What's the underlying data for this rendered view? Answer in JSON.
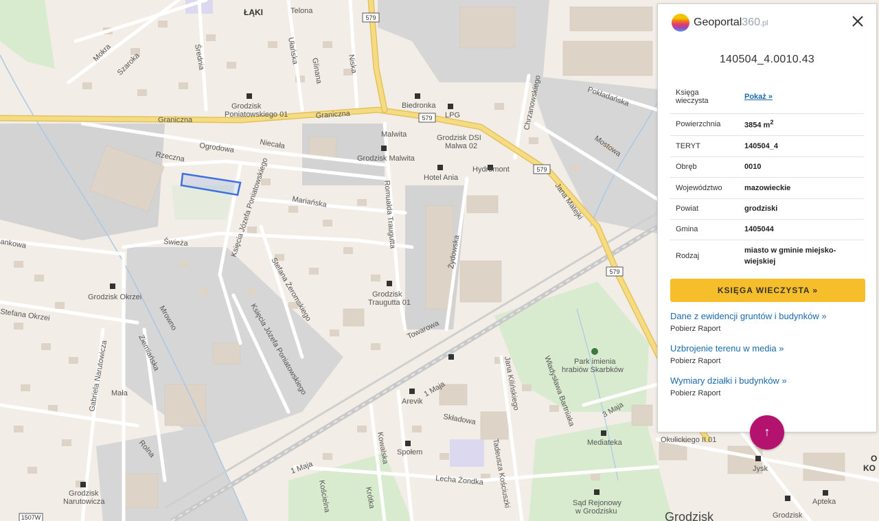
{
  "map": {
    "labels": {
      "laki": "ŁĄKI",
      "telona": "Telona",
      "mokra": "Mokra",
      "szaroka": "Szaroka",
      "srednia": "Średnia",
      "ulanska": "Ułańska",
      "glinana": "Glinana",
      "niska": "Niska",
      "graniczna1": "Graniczna",
      "graniczna2": "Graniczna",
      "stop_poniatowskiego": "Grodzisk\nPoniatowskiego 01",
      "biedronka": "Biedronka",
      "lpg": "LPG",
      "malwita": "Malwita",
      "stop_malwa": "Grodzisk DSI\nMalwa 02",
      "ogrodowa": "Ogrodowa",
      "niecala": "Niecała",
      "rzeczna": "Rzeczna",
      "stop_malwita": "Grodzisk Malwita",
      "hydromont": "Hydromont",
      "hotel_ania": "Hotel Ania",
      "chrzanowskiego": "Chrzanowskiego",
      "pokladanska": "Pokładańska",
      "mostowa": "Mostowa",
      "jana_mateja": "Jana Matejki",
      "marianska": "Mariańska",
      "poniatowskiego1": "Księcia Józefa Poniatowskiego",
      "romualda_traugutta": "Romualda Traugutta",
      "zydowska": "Żydowska",
      "swieza": "Świeża",
      "stefana_zeromskiego": "Stefana Żeromskiego",
      "ksiecia_poniatowskiego2": "Księcia Józefa Poniatowskiego",
      "stop_okrzei": "Grodzisk Okrzei",
      "okrzei": "Stefana Okrzei",
      "rowno": "Mrowno",
      "stop_traugutta": "Grodzisk\nTraugutta 01",
      "towarowa": "Towarowa",
      "kankowa": "ankowa",
      "ziemianska": "Ziemiańska",
      "gabriela": "Gabriela Narutowicza",
      "mala": "Mała",
      "rolna": "Rolna",
      "stop_narutowicza": "Grodzisk\nNarutowicza",
      "arevik": "Arevik",
      "maja1": "1 Maja",
      "maja2": "1 Maja",
      "skladowa": "Składowa",
      "jana_kilinskiego": "Jana Kilińskiego",
      "wladyslawa": "Władysława Bartniaka",
      "park": "Park imienia\nhrabiów Skarbków",
      "maja3": "3 Maja",
      "spolem": "Społem",
      "kowalska": "Kowalska",
      "tadeusza": "Tadeusza Kościuszki",
      "lecha": "Lecha Żondka",
      "mediateka": "Mediateka",
      "sad": "Sąd Rejonowy\nw Grodzisku",
      "okulickiego": "Okulickiego II 01",
      "jysk": "Jysk",
      "apteka": "Apteka",
      "grodzisk": "Grodzisk",
      "grodzisk_stop": "Grodzisk",
      "koscielna": "Kościelna",
      "krotka": "Krótka",
      "ok": "O\nKO",
      "shield_579_a": "579",
      "shield_579_b": "579",
      "shield_579_c": "579",
      "shield_579_d": "579",
      "shield_1507": "1507W"
    },
    "colors": {
      "background": "#f2ede6",
      "building": "#ddd3c6",
      "industrial": "#d3d3d3",
      "green": "#d9ebcf",
      "main_road": "#f5dc82",
      "rail": "#c9c9c9",
      "selected_parcel": "#3d6fe0"
    }
  },
  "panel": {
    "logo": {
      "main": "Geoportal",
      "num": "360",
      "tld": ".pl"
    },
    "parcel_id": "140504_4.0010.43",
    "rows": [
      {
        "key": "Księga wieczysta",
        "value": "Pokaż »",
        "is_link": true
      },
      {
        "key": "Powierzchnia",
        "value": "3854 m",
        "sup": "2"
      },
      {
        "key": "TERYT",
        "value": "140504_4"
      },
      {
        "key": "Obręb",
        "value": "0010"
      },
      {
        "key": "Województwo",
        "value": "mazowieckie"
      },
      {
        "key": "Powiat",
        "value": "grodziski"
      },
      {
        "key": "Gmina",
        "value": "1405044"
      },
      {
        "key": "Rodzaj",
        "value": "miasto w gminie miejsko-wiejskiej"
      }
    ],
    "kw_button": "KSIĘGA WIECZYSTA »",
    "links": [
      {
        "label": "Dane z ewidencji gruntów i budynków »",
        "sub": "Pobierz Raport"
      },
      {
        "label": "Uzbrojenie terenu w media »",
        "sub": "Pobierz Raport"
      },
      {
        "label": "Wymiary działki i budynków »",
        "sub": "Pobierz Raport"
      }
    ],
    "close_icon": "close-icon",
    "up_icon": "arrow-up-icon",
    "up_symbol": "↑"
  }
}
